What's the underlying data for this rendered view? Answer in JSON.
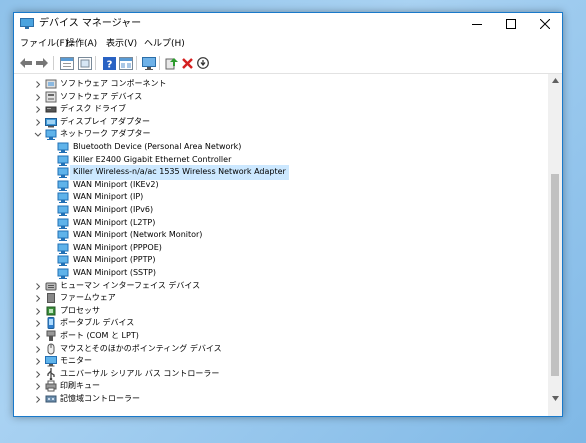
{
  "window": {
    "title": "デバイス マネージャー"
  },
  "menu": [
    "ファイル(F)",
    "操作(A)",
    "表示(V)",
    "ヘルプ(H)"
  ],
  "toolbar_icons": [
    "back-arrow-icon",
    "forward-arrow-icon",
    "properties-icon",
    "show-hidden-icon",
    "help-icon",
    "view-toggle-icon",
    "monitor-icon",
    "update-driver-icon",
    "uninstall-icon",
    "disable-device-icon"
  ],
  "tree": [
    {
      "label": "ソフトウェア コンポーネント",
      "level": 0,
      "expanded": false,
      "icon": "software-component-icon"
    },
    {
      "label": "ソフトウェア デバイス",
      "level": 0,
      "expanded": false,
      "icon": "software-device-icon"
    },
    {
      "label": "ディスク ドライブ",
      "level": 0,
      "expanded": false,
      "icon": "disk-drive-icon"
    },
    {
      "label": "ディスプレイ アダプター",
      "level": 0,
      "expanded": false,
      "icon": "display-adapter-icon"
    },
    {
      "label": "ネットワーク アダプター",
      "level": 0,
      "expanded": true,
      "icon": "network-adapter-icon"
    },
    {
      "label": "Bluetooth Device (Personal Area Network)",
      "level": 1,
      "icon": "network-adapter-icon"
    },
    {
      "label": "Killer E2400 Gigabit Ethernet Controller",
      "level": 1,
      "icon": "network-adapter-icon"
    },
    {
      "label": "Killer Wireless-n/a/ac 1535 Wireless Network Adapter",
      "level": 1,
      "icon": "network-adapter-icon",
      "selected": true
    },
    {
      "label": "WAN Miniport (IKEv2)",
      "level": 1,
      "icon": "network-adapter-icon"
    },
    {
      "label": "WAN Miniport (IP)",
      "level": 1,
      "icon": "network-adapter-icon"
    },
    {
      "label": "WAN Miniport (IPv6)",
      "level": 1,
      "icon": "network-adapter-icon"
    },
    {
      "label": "WAN Miniport (L2TP)",
      "level": 1,
      "icon": "network-adapter-icon"
    },
    {
      "label": "WAN Miniport (Network Monitor)",
      "level": 1,
      "icon": "network-adapter-icon"
    },
    {
      "label": "WAN Miniport (PPPOE)",
      "level": 1,
      "icon": "network-adapter-icon"
    },
    {
      "label": "WAN Miniport (PPTP)",
      "level": 1,
      "icon": "network-adapter-icon"
    },
    {
      "label": "WAN Miniport (SSTP)",
      "level": 1,
      "icon": "network-adapter-icon"
    },
    {
      "label": "ヒューマン インターフェイス デバイス",
      "level": 0,
      "expanded": false,
      "icon": "hid-icon"
    },
    {
      "label": "ファームウェア",
      "level": 0,
      "expanded": false,
      "icon": "firmware-icon"
    },
    {
      "label": "プロセッサ",
      "level": 0,
      "expanded": false,
      "icon": "processor-icon"
    },
    {
      "label": "ポータブル デバイス",
      "level": 0,
      "expanded": false,
      "icon": "portable-device-icon"
    },
    {
      "label": "ポート (COM と LPT)",
      "level": 0,
      "expanded": false,
      "icon": "port-icon"
    },
    {
      "label": "マウスとそのほかのポインティング デバイス",
      "level": 0,
      "expanded": false,
      "icon": "mouse-icon"
    },
    {
      "label": "モニター",
      "level": 0,
      "expanded": false,
      "icon": "monitor-icon"
    },
    {
      "label": "ユニバーサル シリアル バス コントローラー",
      "level": 0,
      "expanded": false,
      "icon": "usb-icon"
    },
    {
      "label": "印刷キュー",
      "level": 0,
      "expanded": false,
      "icon": "printer-icon"
    },
    {
      "label": "記憶域コントローラー",
      "level": 0,
      "expanded": false,
      "icon": "storage-controller-icon"
    }
  ],
  "colors": {
    "selection": "#cce8ff",
    "accent": "#1979ca",
    "desktop": "#8fc2ea"
  }
}
